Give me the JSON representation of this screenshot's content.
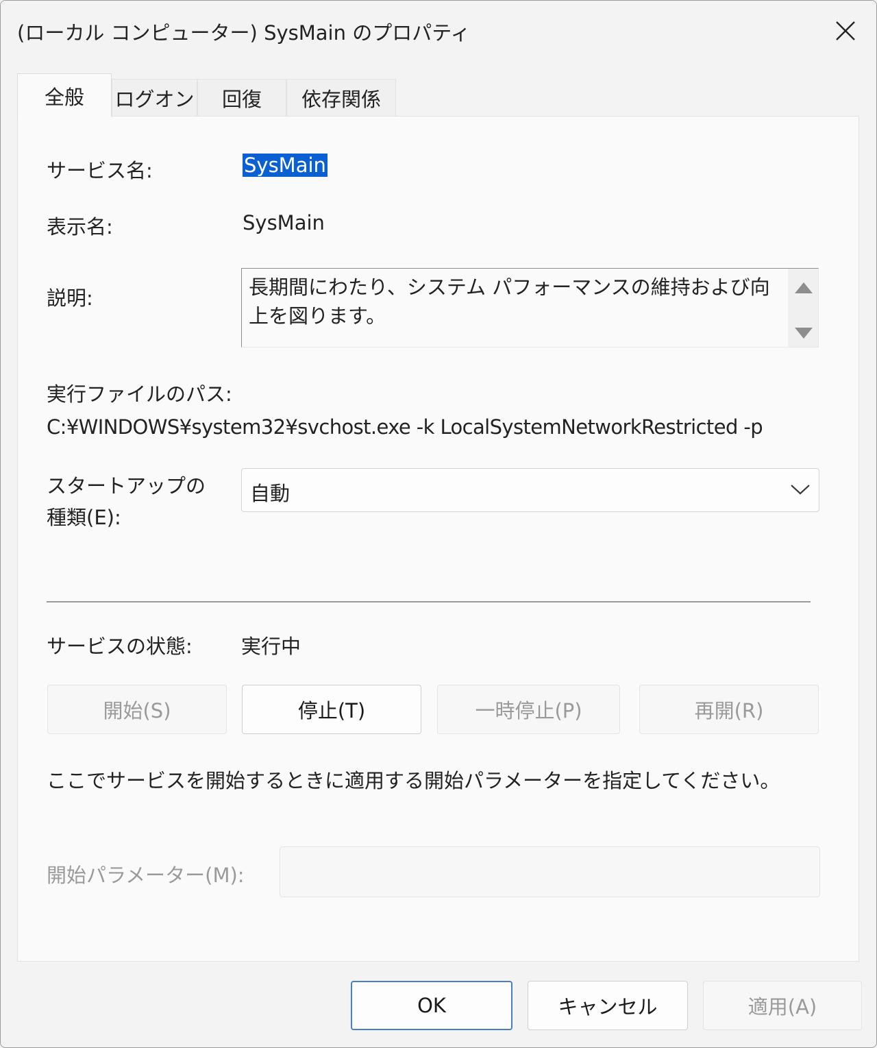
{
  "window": {
    "title": "(ローカル コンピューター) SysMain のプロパティ"
  },
  "tabs": [
    {
      "label": "全般"
    },
    {
      "label": "ログオン"
    },
    {
      "label": "回復"
    },
    {
      "label": "依存関係"
    }
  ],
  "general": {
    "service_name_label": "サービス名:",
    "service_name_value": "SysMain",
    "display_name_label": "表示名:",
    "display_name_value": "SysMain",
    "description_label": "説明:",
    "description_value": "長期間にわたり、システム パフォーマンスの維持および向上を図ります。",
    "path_label": "実行ファイルのパス:",
    "path_value": "C:¥WINDOWS¥system32¥svchost.exe -k LocalSystemNetworkRestricted -p",
    "startup_type_label_line1": "スタートアップの",
    "startup_type_label_line2": "種類(E):",
    "startup_type_value": "自動",
    "status_label": "サービスの状態:",
    "status_value": "実行中",
    "buttons": {
      "start": "開始(S)",
      "stop": "停止(T)",
      "pause": "一時停止(P)",
      "resume": "再開(R)"
    },
    "params_hint": "ここでサービスを開始するときに適用する開始パラメーターを指定してください。",
    "params_label": "開始パラメーター(M):",
    "params_value": ""
  },
  "dialog_buttons": {
    "ok": "OK",
    "cancel": "キャンセル",
    "apply": "適用(A)"
  },
  "colors": {
    "selection": "#0a5fd2",
    "default_button_border": "#4a7fc7",
    "disabled_text": "#9a9a9a"
  }
}
